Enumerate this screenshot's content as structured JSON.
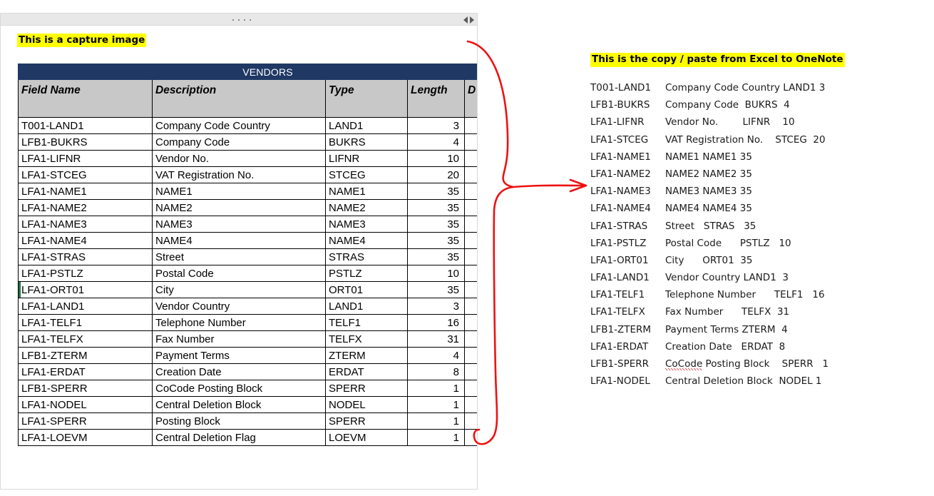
{
  "capture_window": {
    "toolbar": {
      "drag_handle_icon": "drag-dots-icon",
      "prev_icon": "arrow-left-icon",
      "next_icon": "arrow-right-icon"
    },
    "note": "This is a capture image",
    "table": {
      "banner": "VENDORS",
      "columns": [
        "Field Name",
        "Description",
        "Type",
        "Length",
        "D"
      ],
      "rows": [
        {
          "field": "T001-LAND1",
          "description": "Company Code Country",
          "type": "LAND1",
          "length": "3"
        },
        {
          "field": "LFB1-BUKRS",
          "description": "Company Code",
          "type": "BUKRS",
          "length": "4"
        },
        {
          "field": "LFA1-LIFNR",
          "description": "Vendor No.",
          "type": "LIFNR",
          "length": "10"
        },
        {
          "field": "LFA1-STCEG",
          "description": "VAT Registration No.",
          "type": "STCEG",
          "length": "20"
        },
        {
          "field": "LFA1-NAME1",
          "description": "NAME1",
          "type": "NAME1",
          "length": "35"
        },
        {
          "field": "LFA1-NAME2",
          "description": "NAME2",
          "type": "NAME2",
          "length": "35"
        },
        {
          "field": "LFA1-NAME3",
          "description": "NAME3",
          "type": "NAME3",
          "length": "35"
        },
        {
          "field": "LFA1-NAME4",
          "description": "NAME4",
          "type": "NAME4",
          "length": "35"
        },
        {
          "field": "LFA1-STRAS",
          "description": "Street",
          "type": "STRAS",
          "length": "35"
        },
        {
          "field": "LFA1-PSTLZ",
          "description": "Postal Code",
          "type": "PSTLZ",
          "length": "10"
        },
        {
          "field": "LFA1-ORT01",
          "description": "City",
          "type": "ORT01",
          "length": "35",
          "selected": true
        },
        {
          "field": "LFA1-LAND1",
          "description": "Vendor Country",
          "type": "LAND1",
          "length": "3"
        },
        {
          "field": "LFA1-TELF1",
          "description": "Telephone Number",
          "type": "TELF1",
          "length": "16"
        },
        {
          "field": "LFA1-TELFX",
          "description": "Fax Number",
          "type": "TELFX",
          "length": "31"
        },
        {
          "field": "LFB1-ZTERM",
          "description": "Payment Terms",
          "type": "ZTERM",
          "length": "4"
        },
        {
          "field": "LFA1-ERDAT",
          "description": "Creation Date",
          "type": "ERDAT",
          "length": "8"
        },
        {
          "field": "LFB1-SPERR",
          "description": "CoCode Posting Block",
          "type": "SPERR",
          "length": "1"
        },
        {
          "field": "LFA1-NODEL",
          "description": "Central Deletion Block",
          "type": "NODEL",
          "length": "1"
        },
        {
          "field": "LFA1-SPERR",
          "description": "Posting Block",
          "type": "SPERR",
          "length": "1"
        },
        {
          "field": "LFA1-LOEVM",
          "description": "Central Deletion Flag",
          "type": "LOEVM",
          "length": "1"
        }
      ]
    }
  },
  "annotation": {
    "arrow_color": "#ee1111",
    "arrow_icon": "curved-arrow-icon"
  },
  "onenote_panel": {
    "note": "This is the copy / paste from Excel to OneNote",
    "lines": [
      {
        "field": "T001-LAND1",
        "rest": "Company Code Country LAND1 3"
      },
      {
        "field": "LFB1-BUKRS",
        "rest": "Company Code  BUKRS  4"
      },
      {
        "field": "LFA1-LIFNR",
        "rest": "Vendor No.        LIFNR    10"
      },
      {
        "field": "LFA1-STCEG",
        "rest": "VAT Registration No.    STCEG  20"
      },
      {
        "field": "LFA1-NAME1",
        "rest": "NAME1 NAME1 35"
      },
      {
        "field": "LFA1-NAME2",
        "rest": "NAME2 NAME2 35"
      },
      {
        "field": "LFA1-NAME3",
        "rest": "NAME3 NAME3 35"
      },
      {
        "field": "LFA1-NAME4",
        "rest": "NAME4 NAME4 35"
      },
      {
        "field": "LFA1-STRAS",
        "rest": "Street   STRAS   35"
      },
      {
        "field": "LFA1-PSTLZ",
        "rest": "Postal Code      PSTLZ   10"
      },
      {
        "field": "LFA1-ORT01",
        "rest": "City      ORT01  35"
      },
      {
        "field": "LFA1-LAND1",
        "rest": "Vendor Country LAND1  3"
      },
      {
        "field": "LFA1-TELF1",
        "rest": "Telephone Number      TELF1   16"
      },
      {
        "field": "LFA1-TELFX",
        "rest": "Fax Number      TELFX  31"
      },
      {
        "field": "LFB1-ZTERM",
        "rest": "Payment Terms ZTERM  4"
      },
      {
        "field": "LFA1-ERDAT",
        "rest": "Creation Date   ERDAT  8"
      },
      {
        "field": "LFB1-SPERR",
        "rest_misspelled": "CoCode",
        "rest": " Posting Block    SPERR   1"
      },
      {
        "field": "LFA1-NODEL",
        "rest": "Central Deletion Block  NODEL 1"
      }
    ]
  }
}
